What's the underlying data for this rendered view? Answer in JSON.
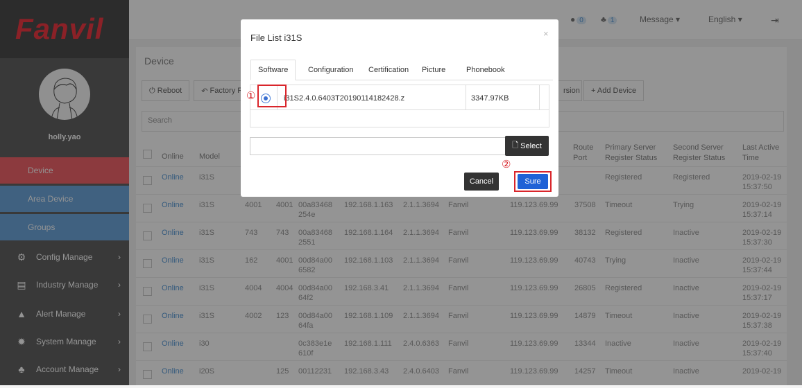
{
  "brand": {
    "logo_text": "Fanvil",
    "accent": "#ef3a44"
  },
  "sidebar": {
    "username": "holly.yao",
    "tabs": [
      {
        "label": "Device",
        "color": "#f2646c",
        "active": true
      },
      {
        "label": "Area Device",
        "color": "#6ea7dd"
      },
      {
        "label": "Groups",
        "color": "#6ea7dd"
      }
    ],
    "menu": [
      {
        "label": "Config Manage",
        "icon": "gears-icon"
      },
      {
        "label": "Industry Manage",
        "icon": "building-icon"
      },
      {
        "label": "Alert Manage",
        "icon": "warning-icon"
      },
      {
        "label": "System Manage",
        "icon": "gear-icon"
      },
      {
        "label": "Account Manage",
        "icon": "users-icon"
      }
    ]
  },
  "topbar": {
    "chat_count": "0",
    "alert_count": "1",
    "message_label": "Message",
    "language_label": "English"
  },
  "panel": {
    "title": "Device",
    "toolbar": {
      "reboot": "Reboot",
      "factory": "Factory Re",
      "version": "rsion",
      "add": "+ Add Device"
    },
    "search_placeholder": "Search",
    "headers": {
      "online": "Online",
      "model": "Model",
      "route_port": "Route Port",
      "primary": "Primary Server Register Status",
      "second": "Second Server Register Status",
      "last_active": "Last Active Time"
    },
    "rows": [
      {
        "online": "Online",
        "model": "i31S",
        "acc1": "",
        "acc2": "",
        "mac": "",
        "ip": "",
        "ver": "",
        "brand": "",
        "server": "",
        "port": "",
        "primary": "Registered",
        "second": "Registered",
        "date": "2019-02-19",
        "time": "15:37:50"
      },
      {
        "online": "Online",
        "model": "i31S",
        "acc1": "4001",
        "acc2": "4001",
        "mac": "00a83468",
        "mac2": "254e",
        "ip": "192.168.1.163",
        "ver": "2.1.1.3694",
        "brand": "Fanvil",
        "server": "119.123.69.99",
        "port": "37508",
        "primary": "Timeout",
        "second": "Trying",
        "date": "2019-02-19",
        "time": "15:37:14"
      },
      {
        "online": "Online",
        "model": "i31S",
        "acc1": "743",
        "acc2": "743",
        "mac": "00a83468",
        "mac2": "2551",
        "ip": "192.168.1.164",
        "ver": "2.1.1.3694",
        "brand": "Fanvil",
        "server": "119.123.69.99",
        "port": "38132",
        "primary": "Registered",
        "second": "Inactive",
        "date": "2019-02-19",
        "time": "15:37:30"
      },
      {
        "online": "Online",
        "model": "i31S",
        "acc1": "162",
        "acc2": "4001",
        "mac": "00d84a00",
        "mac2": "6582",
        "ip": "192.168.1.103",
        "ver": "2.1.1.3694",
        "brand": "Fanvil",
        "server": "119.123.69.99",
        "port": "40743",
        "primary": "Trying",
        "second": "Inactive",
        "date": "2019-02-19",
        "time": "15:37:44"
      },
      {
        "online": "Online",
        "model": "i31S",
        "acc1": "4004",
        "acc2": "4004",
        "mac": "00d84a00",
        "mac2": "64f2",
        "ip": "192.168.3.41",
        "ver": "2.1.1.3694",
        "brand": "Fanvil",
        "server": "119.123.69.99",
        "port": "26805",
        "primary": "Registered",
        "second": "Inactive",
        "date": "2019-02-19",
        "time": "15:37:17"
      },
      {
        "online": "Online",
        "model": "i31S",
        "acc1": "4002",
        "acc2": "123",
        "mac": "00d84a00",
        "mac2": "64fa",
        "ip": "192.168.1.109",
        "ver": "2.1.1.3694",
        "brand": "Fanvil",
        "server": "119.123.69.99",
        "port": "14879",
        "primary": "Timeout",
        "second": "Inactive",
        "date": "2019-02-19",
        "time": "15:37:38"
      },
      {
        "online": "Online",
        "model": "i30",
        "acc1": "",
        "acc2": "",
        "mac": "0c383e1e",
        "mac2": "610f",
        "ip": "192.168.1.111",
        "ver": "2.4.0.6363",
        "brand": "Fanvil",
        "server": "119.123.69.99",
        "port": "13344",
        "primary": "Inactive",
        "second": "Inactive",
        "date": "2019-02-19",
        "time": "15:37:40"
      },
      {
        "online": "Online",
        "model": "i20S",
        "acc1": "",
        "acc2": "125",
        "mac": "00112231",
        "mac2": "",
        "ip": "192.168.3.43",
        "ver": "2.4.0.6403",
        "brand": "Fanvil",
        "server": "119.123.69.99",
        "port": "14257",
        "primary": "Timeout",
        "second": "Inactive",
        "date": "2019-02-19",
        "time": ""
      }
    ]
  },
  "dialog": {
    "title": "File List  i31S",
    "close": "×",
    "tabs": [
      "Software",
      "Configuration",
      "Certification",
      "Picture",
      "Phonebook"
    ],
    "file_name": "i31S2.4.0.6403T20190114182428.z",
    "file_size": "3347.97KB",
    "select_label": "Select",
    "cancel_label": "Cancel",
    "sure_label": "Sure",
    "marker1": "①",
    "marker2": "②"
  }
}
